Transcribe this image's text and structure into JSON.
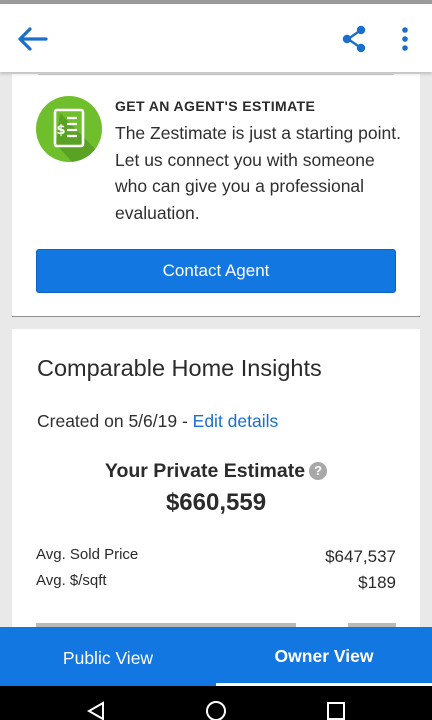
{
  "header": {
    "back_icon": "arrow-left-icon",
    "share_icon": "share-icon",
    "more_icon": "more-vertical-icon",
    "accent_color": "#1a6fcd"
  },
  "agent_card": {
    "icon": "document-dollar-icon",
    "icon_color": "#6fbf2d",
    "title": "GET AN AGENT'S ESTIMATE",
    "body": "The Zestimate is just a starting point. Let us connect you with someone who can give you a professional evaluation.",
    "button_label": "Contact Agent",
    "button_color": "#1277e1"
  },
  "insights_card": {
    "title": "Comparable Home Insights",
    "created_prefix": "Created on 5/6/19 - ",
    "edit_link": "Edit details",
    "estimate_label": "Your Private Estimate",
    "help_glyph": "?",
    "estimate_value": "$660,559",
    "stats": [
      {
        "label": "Avg. Sold Price",
        "value": "$647,537"
      },
      {
        "label": "Avg. $/sqft",
        "value": "$189"
      }
    ]
  },
  "tabs": [
    {
      "label": "Public View",
      "active": false
    },
    {
      "label": "Owner View",
      "active": true
    }
  ],
  "system_nav": {
    "back_icon": "nav-back-icon",
    "home_icon": "nav-home-icon",
    "recents_icon": "nav-recents-icon"
  }
}
